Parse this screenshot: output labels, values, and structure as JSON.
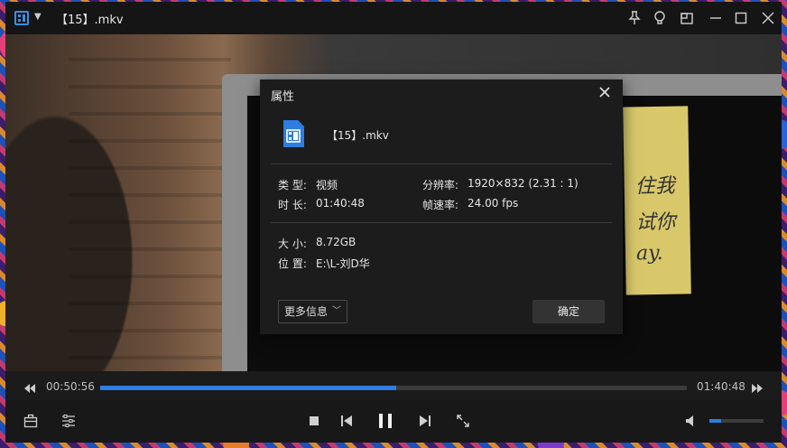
{
  "window": {
    "title": "【15】.mkv",
    "accent": "#2f7de0"
  },
  "titlebar_icons": [
    "app-logo-icon",
    "pin-icon",
    "bulb-icon",
    "miniview-icon",
    "minimize-icon",
    "maximize-icon",
    "close-icon"
  ],
  "dialog": {
    "title": "属性",
    "file_name": "【15】.mkv",
    "type_label": "类  型:",
    "type_value": "视频",
    "duration_label": "时  长:",
    "duration_value": "01:40:48",
    "resolution_label": "分辨率:",
    "resolution_value": "1920×832 (2.31 : 1)",
    "framerate_label": "帧速率:",
    "framerate_value": "24.00 fps",
    "size_label": "大  小:",
    "size_value": "8.72GB",
    "location_label": "位  置:",
    "location_value": "E:\\L-刘D华",
    "more_info_label": "更多信息",
    "ok_label": "确定"
  },
  "playback": {
    "current_time": "00:50:56",
    "total_time": "01:40:48",
    "progress_fraction": 0.505,
    "volume_fraction": 0.22
  },
  "video_scene": {
    "sticky_note_lines": [
      "住我",
      "试你",
      "ay."
    ]
  }
}
